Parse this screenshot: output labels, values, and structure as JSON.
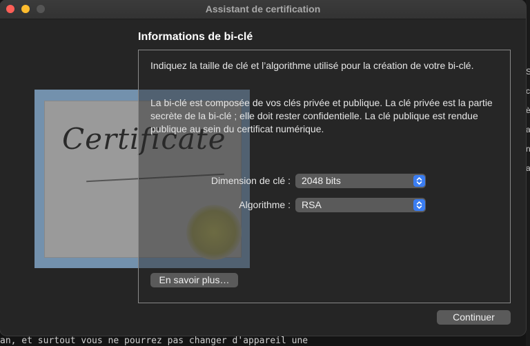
{
  "background": {
    "terminal_text": "an, et surtout vous ne pourrez pas changer d'appareil une",
    "right_edge_glyphs": [
      "S",
      "c",
      "è",
      "a",
      "n",
      "a"
    ]
  },
  "window": {
    "title": "Assistant de certification",
    "section_title": "Informations de bi-clé",
    "illustration_text": "Certificate",
    "intro_text": "Indiquez la taille de clé et l’algorithme utilisé pour la création de votre bi-clé.",
    "description_text": "La bi-clé est composée de vos clés privée et publique. La clé privée est la partie secrète de la bi-clé ; elle doit rester confidentielle. La clé publique est rendue publique au sein du certificat numérique.",
    "key_size": {
      "label": "Dimension de clé :",
      "value": "2048 bits"
    },
    "algorithm": {
      "label": "Algorithme :",
      "value": "RSA"
    },
    "learn_more_button": "En savoir plus…",
    "continue_button": "Continuer"
  },
  "colors": {
    "close": "#ff5f57",
    "minimize": "#febc2e",
    "accent": "#3a7df2"
  }
}
